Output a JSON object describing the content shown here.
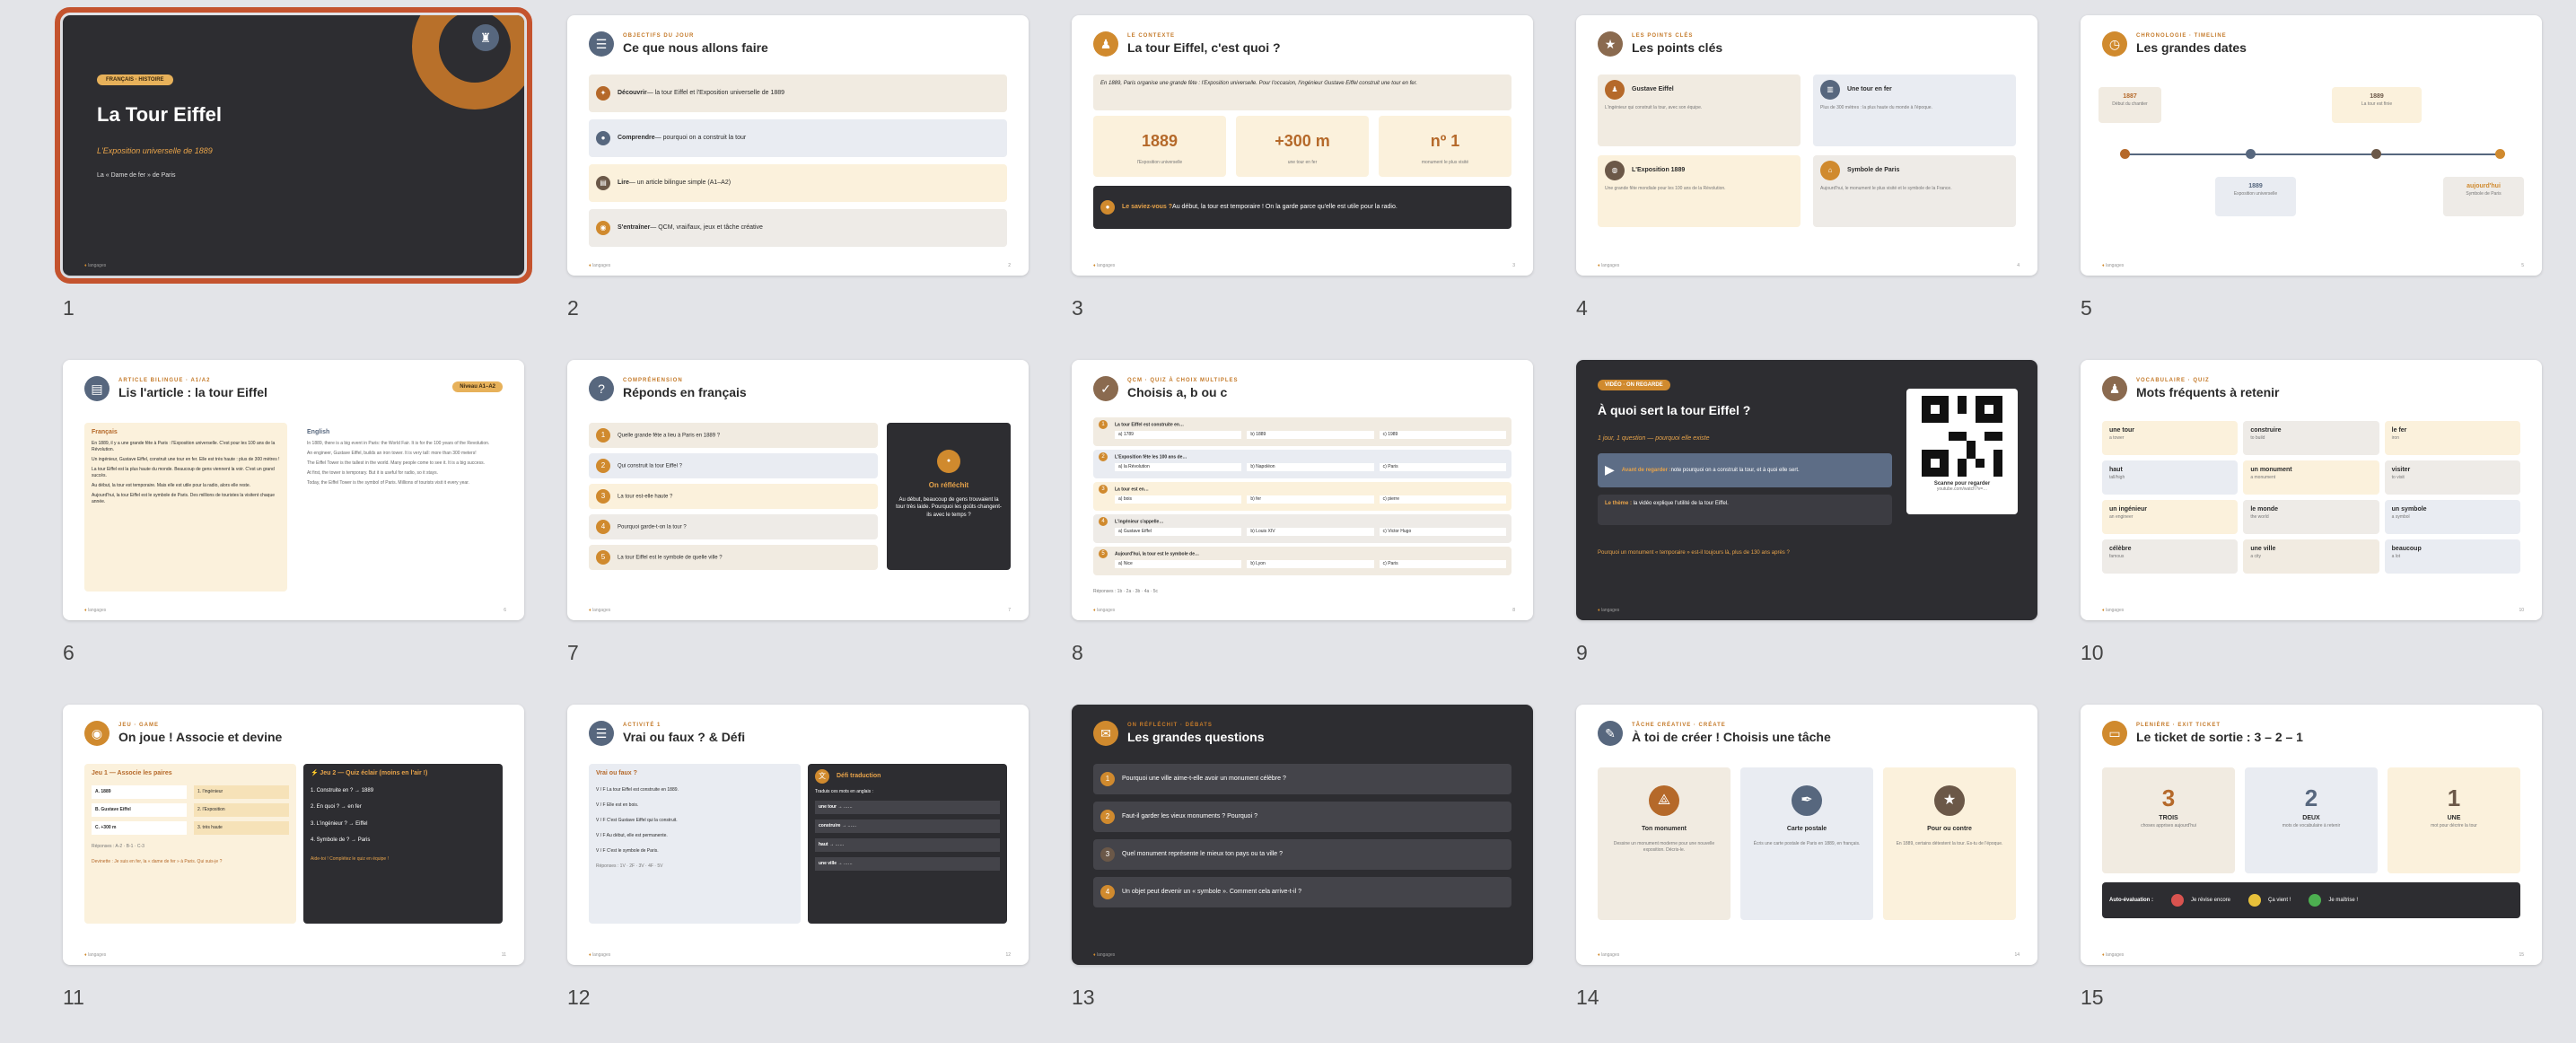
{
  "slides": [
    {
      "n": "1",
      "tag": "FRANÇAIS · HISTOIRE",
      "title": "La Tour Eiffel",
      "subtitle": "L'Exposition universelle de 1889",
      "line": "La « Dame de fer » de Paris"
    },
    {
      "n": "2",
      "kicker": "OBJECTIFS DU JOUR",
      "title": "Ce que nous allons faire",
      "items": [
        {
          "b": "Découvrir",
          "t": " — la tour Eiffel et l'Exposition universelle de 1889"
        },
        {
          "b": "Comprendre",
          "t": " — pourquoi on a construit la tour"
        },
        {
          "b": "Lire",
          "t": " — un article bilingue simple (A1–A2)"
        },
        {
          "b": "S'entraîner",
          "t": " — QCM, vrai/faux, jeux et tâche créative"
        }
      ]
    },
    {
      "n": "3",
      "kicker": "LE CONTEXTE",
      "title": "La tour Eiffel, c'est quoi ?",
      "intro": "En 1889, Paris organise une grande fête : l'Exposition universelle. Pour l'occasion, l'ingénieur Gustave Eiffel construit une tour en fer.",
      "stats": [
        {
          "v": "1889",
          "l": "l'Exposition universelle"
        },
        {
          "v": "+300 m",
          "l": "une tour en fer"
        },
        {
          "v": "nº 1",
          "l": "monument le plus visité"
        }
      ],
      "note_b": "Le saviez-vous ?",
      "note": " Au début, la tour est temporaire ! On la garde parce qu'elle est utile pour la radio."
    },
    {
      "n": "4",
      "kicker": "LES POINTS CLÉS",
      "title": "Les points clés",
      "cards": [
        {
          "t": "Gustave Eiffel",
          "d": "L'ingénieur qui construit la tour, avec son équipe."
        },
        {
          "t": "Une tour en fer",
          "d": "Plus de 300 mètres : la plus haute du monde à l'époque."
        },
        {
          "t": "L'Exposition 1889",
          "d": "Une grande fête mondiale pour les 100 ans de la Révolution."
        },
        {
          "t": "Symbole de Paris",
          "d": "Aujourd'hui, le monument le plus visité et le symbole de la France."
        }
      ]
    },
    {
      "n": "5",
      "kicker": "CHRONOLOGIE · TIMELINE",
      "title": "Les grandes dates",
      "dates": [
        {
          "y": "1887",
          "d": "Début du chantier"
        },
        {
          "y": "1889",
          "d": "Exposition universelle"
        },
        {
          "y": "1889",
          "d": "La tour est finie"
        },
        {
          "y": "aujourd'hui",
          "d": "Symbole de Paris"
        }
      ]
    },
    {
      "n": "6",
      "kicker": "ARTICLE BILINGUE · A1/A2",
      "title": "Lis l'article : la tour Eiffel",
      "badge": "Niveau A1–A2",
      "fr_h": "Français",
      "en_h": "English",
      "fr": [
        "En 1889, il y a une grande fête à Paris : l'Exposition universelle. C'est pour les 100 ans de la Révolution.",
        "Un ingénieur, Gustave Eiffel, construit une tour en fer. Elle est très haute : plus de 300 mètres !",
        "La tour Eiffel est la plus haute du monde. Beaucoup de gens viennent la voir. C'est un grand succès.",
        "Au début, la tour est temporaire. Mais elle est utile pour la radio, alors elle reste.",
        "Aujourd'hui, la tour Eiffel est le symbole de Paris. Des millions de touristes la visitent chaque année."
      ],
      "en": [
        "In 1889, there is a big event in Paris: the World Fair. It is for the 100 years of the Revolution.",
        "An engineer, Gustave Eiffel, builds an iron tower. It is very tall: more than 300 meters!",
        "The Eiffel Tower is the tallest in the world. Many people come to see it. It is a big success.",
        "At first, the tower is temporary. But it is useful for radio, so it stays.",
        "Today, the Eiffel Tower is the symbol of Paris. Millions of tourists visit it every year."
      ]
    },
    {
      "n": "7",
      "kicker": "COMPRÉHENSION",
      "title": "Réponds en français",
      "qs": [
        "Quelle grande fête a lieu à Paris en 1889 ?",
        "Qui construit la tour Eiffel ?",
        "La tour est-elle haute ?",
        "Pourquoi garde-t-on la tour ?",
        "La tour Eiffel est le symbole de quelle ville ?"
      ],
      "side_t": "On réfléchit",
      "side": "Au début, beaucoup de gens trouvaient la tour très laide. Pourquoi les goûts changent-ils avec le temps ?"
    },
    {
      "n": "8",
      "kicker": "QCM · QUIZ À CHOIX MULTIPLES",
      "title": "Choisis a, b ou c",
      "qcm": [
        {
          "q": "La tour Eiffel est construite en…",
          "o": [
            "a) 1789",
            "b) 1889",
            "c) 1989"
          ]
        },
        {
          "q": "L'Exposition fête les 100 ans de…",
          "o": [
            "a) la Révolution",
            "b) Napoléon",
            "c) Paris"
          ]
        },
        {
          "q": "La tour est en…",
          "o": [
            "a) bois",
            "b) fer",
            "c) pierre"
          ]
        },
        {
          "q": "L'ingénieur s'appelle…",
          "o": [
            "a) Gustave Eiffel",
            "b) Louis XIV",
            "c) Victor Hugo"
          ]
        },
        {
          "q": "Aujourd'hui, la tour est le symbole de…",
          "o": [
            "a) Nice",
            "b) Lyon",
            "c) Paris"
          ]
        }
      ],
      "ans": "Réponses : 1b · 2a · 3b · 4a · 5c"
    },
    {
      "n": "9",
      "tag": "VIDÉO · ON REGARDE",
      "title": "À quoi sert la tour Eiffel ?",
      "sub": "1 jour, 1 question — pourquoi elle existe",
      "play_b": "Avant de regarder :",
      "play": " note pourquoi on a construit la tour, et à quoi elle sert.",
      "theme_b": "Le thème :",
      "theme": " la vidéo explique l'utilité de la tour Eiffel.",
      "q": "Pourquoi un monument « temporaire » est-il toujours là, plus de 130 ans après ?",
      "qr": "Scanne pour regarder",
      "qr_sub": "youtube.com/watch?v=…"
    },
    {
      "n": "10",
      "kicker": "VOCABULAIRE · QUIZ",
      "title": "Mots fréquents à retenir",
      "words": [
        {
          "w": "une tour",
          "t": "a tower"
        },
        {
          "w": "construire",
          "t": "to build"
        },
        {
          "w": "le fer",
          "t": "iron"
        },
        {
          "w": "haut",
          "t": "tall/high"
        },
        {
          "w": "un monument",
          "t": "a monument"
        },
        {
          "w": "visiter",
          "t": "to visit"
        },
        {
          "w": "un ingénieur",
          "t": "an engineer"
        },
        {
          "w": "le monde",
          "t": "the world"
        },
        {
          "w": "un symbole",
          "t": "a symbol"
        },
        {
          "w": "célèbre",
          "t": "famous"
        },
        {
          "w": "une ville",
          "t": "a city"
        },
        {
          "w": "beaucoup",
          "t": "a lot"
        }
      ]
    },
    {
      "n": "11",
      "kicker": "JEU · GAME",
      "title": "On joue ! Associe et devine",
      "g1": "Jeu 1 — Associe les paires",
      "left": [
        "A. 1889",
        "B. Gustave Eiffel",
        "C. +300 m"
      ],
      "right": [
        "1. l'ingénieur",
        "2. l'Exposition",
        "3. très haute"
      ],
      "g1ans": "Réponses : A-2 · B-1 · C-3",
      "g1q": "Devinette : Je suis en fer, la « dame de fer » à Paris. Qui suis-je ?",
      "g2": "Jeu 2 — Quiz éclair (moins en l'air !)",
      "g2items": [
        "1. Construite en ? → 1889",
        "2. En quoi ? → en fer",
        "3. L'ingénieur ? → Eiffel",
        "4. Symbole de ? → Paris"
      ],
      "g2foot": "Aide-toi ! Complétez le quiz en équipe !"
    },
    {
      "n": "12",
      "kicker": "ACTIVITÉ 1",
      "title": "Vrai ou faux ? & Défi",
      "vf": "Vrai ou faux ?",
      "vfitems": [
        "V / F  La tour Eiffel est construite en 1889.",
        "V / F  Elle est en bois.",
        "V / F  C'est Gustave Eiffel qui la construit.",
        "V / F  Au début, elle est permanente.",
        "V / F  C'est le symbole de Paris."
      ],
      "vfans": "Réponses : 1V · 2F · 3V · 4F · 5V",
      "defi": "Défi traduction",
      "defi_sub": "Traduis ces mots en anglais :",
      "defiw": [
        "une tour",
        "construire",
        "haut",
        "une ville"
      ]
    },
    {
      "n": "13",
      "kicker": "ON RÉFLÉCHIT · DÉBATS",
      "title": "Les grandes questions",
      "qs": [
        "Pourquoi une ville aime-t-elle avoir un monument célèbre ?",
        "Faut-il garder les vieux monuments ? Pourquoi ?",
        "Quel monument représente le mieux ton pays ou ta ville ?",
        "Un objet peut devenir un « symbole ». Comment cela arrive-t-il ?"
      ]
    },
    {
      "n": "14",
      "kicker": "TÂCHE CRÉATIVE · CRÉATE",
      "title": "À toi de créer ! Choisis une tâche",
      "tasks": [
        {
          "t": "Ton monument",
          "d": "Dessine un monument moderne pour une nouvelle exposition. Décris-le."
        },
        {
          "t": "Carte postale",
          "d": "Écris une carte postale de Paris en 1889, en français."
        },
        {
          "t": "Pour ou contre",
          "d": "En 1889, certains détestent la tour. Es-tu de l'époque."
        }
      ]
    },
    {
      "n": "15",
      "kicker": "PLENIÈRE · EXIT TICKET",
      "title": "Le ticket de sortie : 3 – 2 – 1",
      "tix": [
        {
          "v": "3",
          "w": "TROIS",
          "d": "choses apprises aujourd'hui"
        },
        {
          "v": "2",
          "w": "DEUX",
          "d": "mots de vocabulaire à retenir"
        },
        {
          "v": "1",
          "w": "UNE",
          "d": "mot pour décrire la tour"
        }
      ],
      "auto": "Auto-évaluation :",
      "levels": [
        "Je révise encore",
        "Ça vient !",
        "Je maîtrise !"
      ]
    }
  ],
  "footer_brand": "langages",
  "colors": {
    "accent": "#d08a2e",
    "selected": "#c4532e",
    "dark": "#2d2d31"
  }
}
